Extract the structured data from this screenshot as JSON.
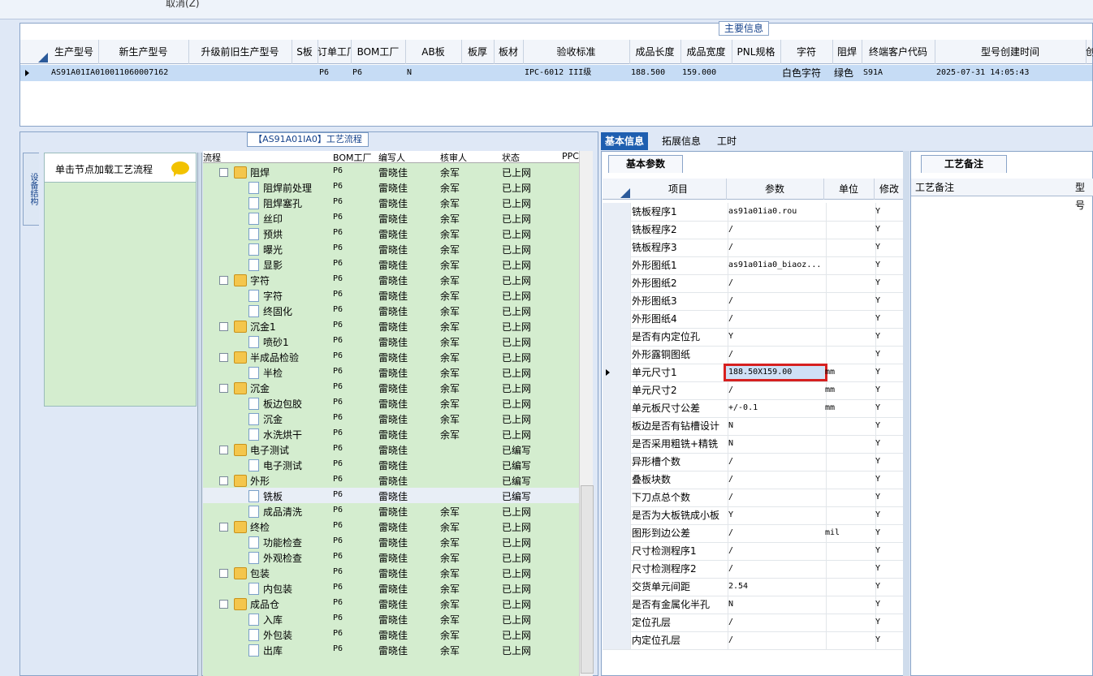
{
  "top": {
    "cancel_label": "取消(Z)"
  },
  "main_info": {
    "title": "主要信息",
    "columns": [
      "生产型号",
      "新生产型号",
      "升级前旧生产型号",
      "S板",
      "订单工厂",
      "BOM工厂",
      "AB板",
      "板厚",
      "板材",
      "验收标准",
      "成品长度",
      "成品宽度",
      "PNL规格",
      "字符",
      "阻焊",
      "终端客户代码",
      "型号创建时间",
      "创建"
    ],
    "row": [
      "AS91A01IA0",
      "10011060007162",
      "",
      "",
      "P6",
      "P6",
      "N",
      "",
      "",
      "IPC-6012 III级",
      "188.500",
      "159.000",
      "",
      "白色字符",
      "绿色",
      "S91A",
      "2025-07-31 14:05:43",
      ""
    ]
  },
  "left": {
    "side_tab": "设备结构",
    "node_hint": "单击节点加载工艺流程",
    "flow_title": "【AS91A01IA0】工艺流程",
    "tree_columns": [
      "流程",
      "BOM工厂",
      "编写人",
      "核审人",
      "状态",
      "PPC"
    ],
    "tree_rows": [
      {
        "name": "阻焊",
        "type": "folder",
        "bom": "P6",
        "writer": "雷晓佳",
        "checker": "余军",
        "status": "已上网"
      },
      {
        "name": "阻焊前处理",
        "type": "doc",
        "bom": "P6",
        "writer": "雷晓佳",
        "checker": "余军",
        "status": "已上网"
      },
      {
        "name": "阻焊塞孔",
        "type": "doc",
        "bom": "P6",
        "writer": "雷晓佳",
        "checker": "余军",
        "status": "已上网"
      },
      {
        "name": "丝印",
        "type": "doc",
        "bom": "P6",
        "writer": "雷晓佳",
        "checker": "余军",
        "status": "已上网"
      },
      {
        "name": "预烘",
        "type": "doc",
        "bom": "P6",
        "writer": "雷晓佳",
        "checker": "余军",
        "status": "已上网"
      },
      {
        "name": "曝光",
        "type": "doc",
        "bom": "P6",
        "writer": "雷晓佳",
        "checker": "余军",
        "status": "已上网"
      },
      {
        "name": "显影",
        "type": "doc",
        "bom": "P6",
        "writer": "雷晓佳",
        "checker": "余军",
        "status": "已上网"
      },
      {
        "name": "字符",
        "type": "folder",
        "bom": "P6",
        "writer": "雷晓佳",
        "checker": "余军",
        "status": "已上网"
      },
      {
        "name": "字符",
        "type": "doc",
        "bom": "P6",
        "writer": "雷晓佳",
        "checker": "余军",
        "status": "已上网"
      },
      {
        "name": "终固化",
        "type": "doc",
        "bom": "P6",
        "writer": "雷晓佳",
        "checker": "余军",
        "status": "已上网"
      },
      {
        "name": "沉金1",
        "type": "folder",
        "bom": "P6",
        "writer": "雷晓佳",
        "checker": "余军",
        "status": "已上网"
      },
      {
        "name": "喷砂1",
        "type": "doc",
        "bom": "P6",
        "writer": "雷晓佳",
        "checker": "余军",
        "status": "已上网"
      },
      {
        "name": "半成品检验",
        "type": "folder",
        "bom": "P6",
        "writer": "雷晓佳",
        "checker": "余军",
        "status": "已上网"
      },
      {
        "name": "半检",
        "type": "doc",
        "bom": "P6",
        "writer": "雷晓佳",
        "checker": "余军",
        "status": "已上网"
      },
      {
        "name": "沉金",
        "type": "folder",
        "bom": "P6",
        "writer": "雷晓佳",
        "checker": "余军",
        "status": "已上网"
      },
      {
        "name": "板边包胶",
        "type": "doc",
        "bom": "P6",
        "writer": "雷晓佳",
        "checker": "余军",
        "status": "已上网"
      },
      {
        "name": "沉金",
        "type": "doc",
        "bom": "P6",
        "writer": "雷晓佳",
        "checker": "余军",
        "status": "已上网"
      },
      {
        "name": "水洗烘干",
        "type": "doc",
        "bom": "P6",
        "writer": "雷晓佳",
        "checker": "余军",
        "status": "已上网"
      },
      {
        "name": "电子测试",
        "type": "folder",
        "bom": "P6",
        "writer": "雷晓佳",
        "checker": "",
        "status": "已编写"
      },
      {
        "name": "电子测试",
        "type": "doc",
        "bom": "P6",
        "writer": "雷晓佳",
        "checker": "",
        "status": "已编写"
      },
      {
        "name": "外形",
        "type": "folder",
        "bom": "P6",
        "writer": "雷晓佳",
        "checker": "",
        "status": "已编写"
      },
      {
        "name": "铣板",
        "type": "doc",
        "bom": "P6",
        "writer": "雷晓佳",
        "checker": "",
        "status": "已编写",
        "selected": true
      },
      {
        "name": "成品清洗",
        "type": "doc",
        "bom": "P6",
        "writer": "雷晓佳",
        "checker": "余军",
        "status": "已上网"
      },
      {
        "name": "终检",
        "type": "folder",
        "bom": "P6",
        "writer": "雷晓佳",
        "checker": "余军",
        "status": "已上网"
      },
      {
        "name": "功能检查",
        "type": "doc",
        "bom": "P6",
        "writer": "雷晓佳",
        "checker": "余军",
        "status": "已上网"
      },
      {
        "name": "外观检查",
        "type": "doc",
        "bom": "P6",
        "writer": "雷晓佳",
        "checker": "余军",
        "status": "已上网"
      },
      {
        "name": "包装",
        "type": "folder",
        "bom": "P6",
        "writer": "雷晓佳",
        "checker": "余军",
        "status": "已上网"
      },
      {
        "name": "内包装",
        "type": "doc",
        "bom": "P6",
        "writer": "雷晓佳",
        "checker": "余军",
        "status": "已上网"
      },
      {
        "name": "成品仓",
        "type": "folder",
        "bom": "P6",
        "writer": "雷晓佳",
        "checker": "余军",
        "status": "已上网"
      },
      {
        "name": "入库",
        "type": "doc",
        "bom": "P6",
        "writer": "雷晓佳",
        "checker": "余军",
        "status": "已上网"
      },
      {
        "name": "外包装",
        "type": "doc",
        "bom": "P6",
        "writer": "雷晓佳",
        "checker": "余军",
        "status": "已上网"
      },
      {
        "name": "出库",
        "type": "doc",
        "bom": "P6",
        "writer": "雷晓佳",
        "checker": "余军",
        "status": "已上网"
      }
    ]
  },
  "right": {
    "tabs": [
      "基本信息",
      "拓展信息",
      "工时"
    ],
    "param_title": "基本参数",
    "param_columns": [
      "项目",
      "参数",
      "单位",
      "修改"
    ],
    "params": [
      {
        "item": "铣板程序1",
        "value": "as91a01ia0.rou",
        "unit": "",
        "mod": "Y"
      },
      {
        "item": "铣板程序2",
        "value": "/",
        "unit": "",
        "mod": "Y"
      },
      {
        "item": "铣板程序3",
        "value": "/",
        "unit": "",
        "mod": "Y"
      },
      {
        "item": "外形图纸1",
        "value": "as91a01ia0_biaoz...",
        "unit": "",
        "mod": "Y"
      },
      {
        "item": "外形图纸2",
        "value": "/",
        "unit": "",
        "mod": "Y"
      },
      {
        "item": "外形图纸3",
        "value": "/",
        "unit": "",
        "mod": "Y"
      },
      {
        "item": "外形图纸4",
        "value": "/",
        "unit": "",
        "mod": "Y"
      },
      {
        "item": "是否有内定位孔",
        "value": "Y",
        "unit": "",
        "mod": "Y"
      },
      {
        "item": "外形露铜图纸",
        "value": "/",
        "unit": "",
        "mod": "Y"
      },
      {
        "item": "单元尺寸1",
        "value": "188.50X159.00",
        "unit": "mm",
        "mod": "Y",
        "current": true
      },
      {
        "item": "单元尺寸2",
        "value": "/",
        "unit": "mm",
        "mod": "Y"
      },
      {
        "item": "单元板尺寸公差",
        "value": "+/-0.1",
        "unit": "mm",
        "mod": "Y"
      },
      {
        "item": "板边是否有钻槽设计",
        "value": "N",
        "unit": "",
        "mod": "Y"
      },
      {
        "item": "是否采用粗铣+精铣",
        "value": "N",
        "unit": "",
        "mod": "Y"
      },
      {
        "item": "异形槽个数",
        "value": "/",
        "unit": "",
        "mod": "Y"
      },
      {
        "item": "叠板块数",
        "value": "/",
        "unit": "",
        "mod": "Y"
      },
      {
        "item": "下刀点总个数",
        "value": "/",
        "unit": "",
        "mod": "Y"
      },
      {
        "item": "是否为大板铣成小板",
        "value": "Y",
        "unit": "",
        "mod": "Y"
      },
      {
        "item": "图形到边公差",
        "value": "/",
        "unit": "mil",
        "mod": "Y"
      },
      {
        "item": "尺寸检测程序1",
        "value": "/",
        "unit": "",
        "mod": "Y"
      },
      {
        "item": "尺寸检测程序2",
        "value": "/",
        "unit": "",
        "mod": "Y"
      },
      {
        "item": "交货单元间距",
        "value": "2.54",
        "unit": "",
        "mod": "Y"
      },
      {
        "item": "是否有金属化半孔",
        "value": "N",
        "unit": "",
        "mod": "Y"
      },
      {
        "item": "定位孔层",
        "value": "/",
        "unit": "",
        "mod": "Y"
      },
      {
        "item": "内定位孔层",
        "value": "/",
        "unit": "",
        "mod": "Y"
      }
    ],
    "note_title": "工艺备注",
    "note_columns": [
      "工艺备注",
      "型号"
    ]
  }
}
